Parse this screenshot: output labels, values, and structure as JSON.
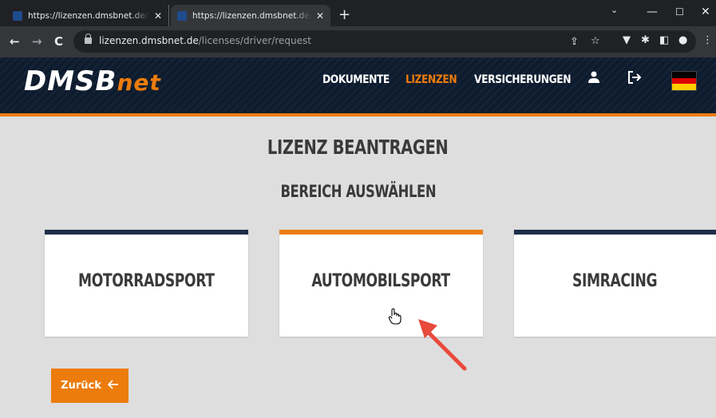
{
  "browser": {
    "tabs": [
      {
        "title": "https://lizenzen.dmsbnet.de/licen",
        "active": false
      },
      {
        "title": "https://lizenzen.dmsbnet.de/licen",
        "active": true
      }
    ],
    "url_domain": "lizenzen.dmsbnet.de",
    "url_path": "/licenses/driver/request"
  },
  "site": {
    "logo_main": "DMSB",
    "logo_suffix": "net",
    "nav": [
      "DOKUMENTE",
      "LIZENZEN",
      "VERSICHERUNGEN"
    ],
    "active_nav": "LIZENZEN"
  },
  "page": {
    "title": "LIZENZ BEANTRAGEN",
    "subtitle": "BEREICH AUSWÄHLEN",
    "cards": [
      {
        "label": "MOTORRADSPORT",
        "active": false
      },
      {
        "label": "AUTOMOBILSPORT",
        "active": true
      },
      {
        "label": "SIMRACING",
        "active": false
      }
    ],
    "back_label": "Zurück"
  },
  "colors": {
    "accent": "#ec7c0c",
    "navy": "#1e2e48",
    "annotation": "#e84a3c"
  }
}
